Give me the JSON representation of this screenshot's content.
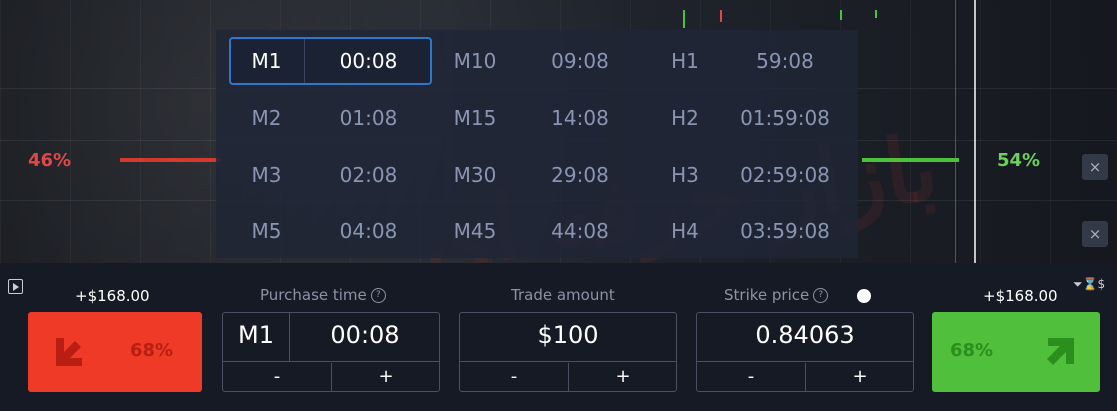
{
  "expiry_grid": {
    "rows": [
      [
        {
          "tf": "M1",
          "time": "00:08"
        },
        {
          "tf": "M10",
          "time": "09:08"
        },
        {
          "tf": "H1",
          "time": "59:08"
        }
      ],
      [
        {
          "tf": "M2",
          "time": "01:08"
        },
        {
          "tf": "M15",
          "time": "14:08"
        },
        {
          "tf": "H2",
          "time": "01:59:08"
        }
      ],
      [
        {
          "tf": "M3",
          "time": "02:08"
        },
        {
          "tf": "M30",
          "time": "29:08"
        },
        {
          "tf": "H3",
          "time": "02:59:08"
        }
      ],
      [
        {
          "tf": "M5",
          "time": "04:08"
        },
        {
          "tf": "M45",
          "time": "44:08"
        },
        {
          "tf": "H4",
          "time": "03:59:08"
        }
      ]
    ],
    "selected": "M1"
  },
  "sentiment": {
    "down_pct": "46%",
    "up_pct": "54%"
  },
  "payout_left": "+$168.00",
  "payout_right": "+$168.00",
  "down_button": {
    "pct": "68%",
    "color": "#ef3a27"
  },
  "up_button": {
    "pct": "68%",
    "color": "#4fbf3c"
  },
  "purchase_time": {
    "label": "Purchase time",
    "timeframe": "M1",
    "value": "00:08",
    "minus": "-",
    "plus": "+"
  },
  "trade_amount": {
    "label": "Trade amount",
    "value": "$100",
    "minus": "-",
    "plus": "+"
  },
  "strike_price": {
    "label": "Strike price",
    "value": "0.84063",
    "minus": "-",
    "plus": "+"
  },
  "icons": {
    "close": "×",
    "help": "?",
    "top_right": "⏷⌛$"
  },
  "watermark": "بازار حرفه ای"
}
